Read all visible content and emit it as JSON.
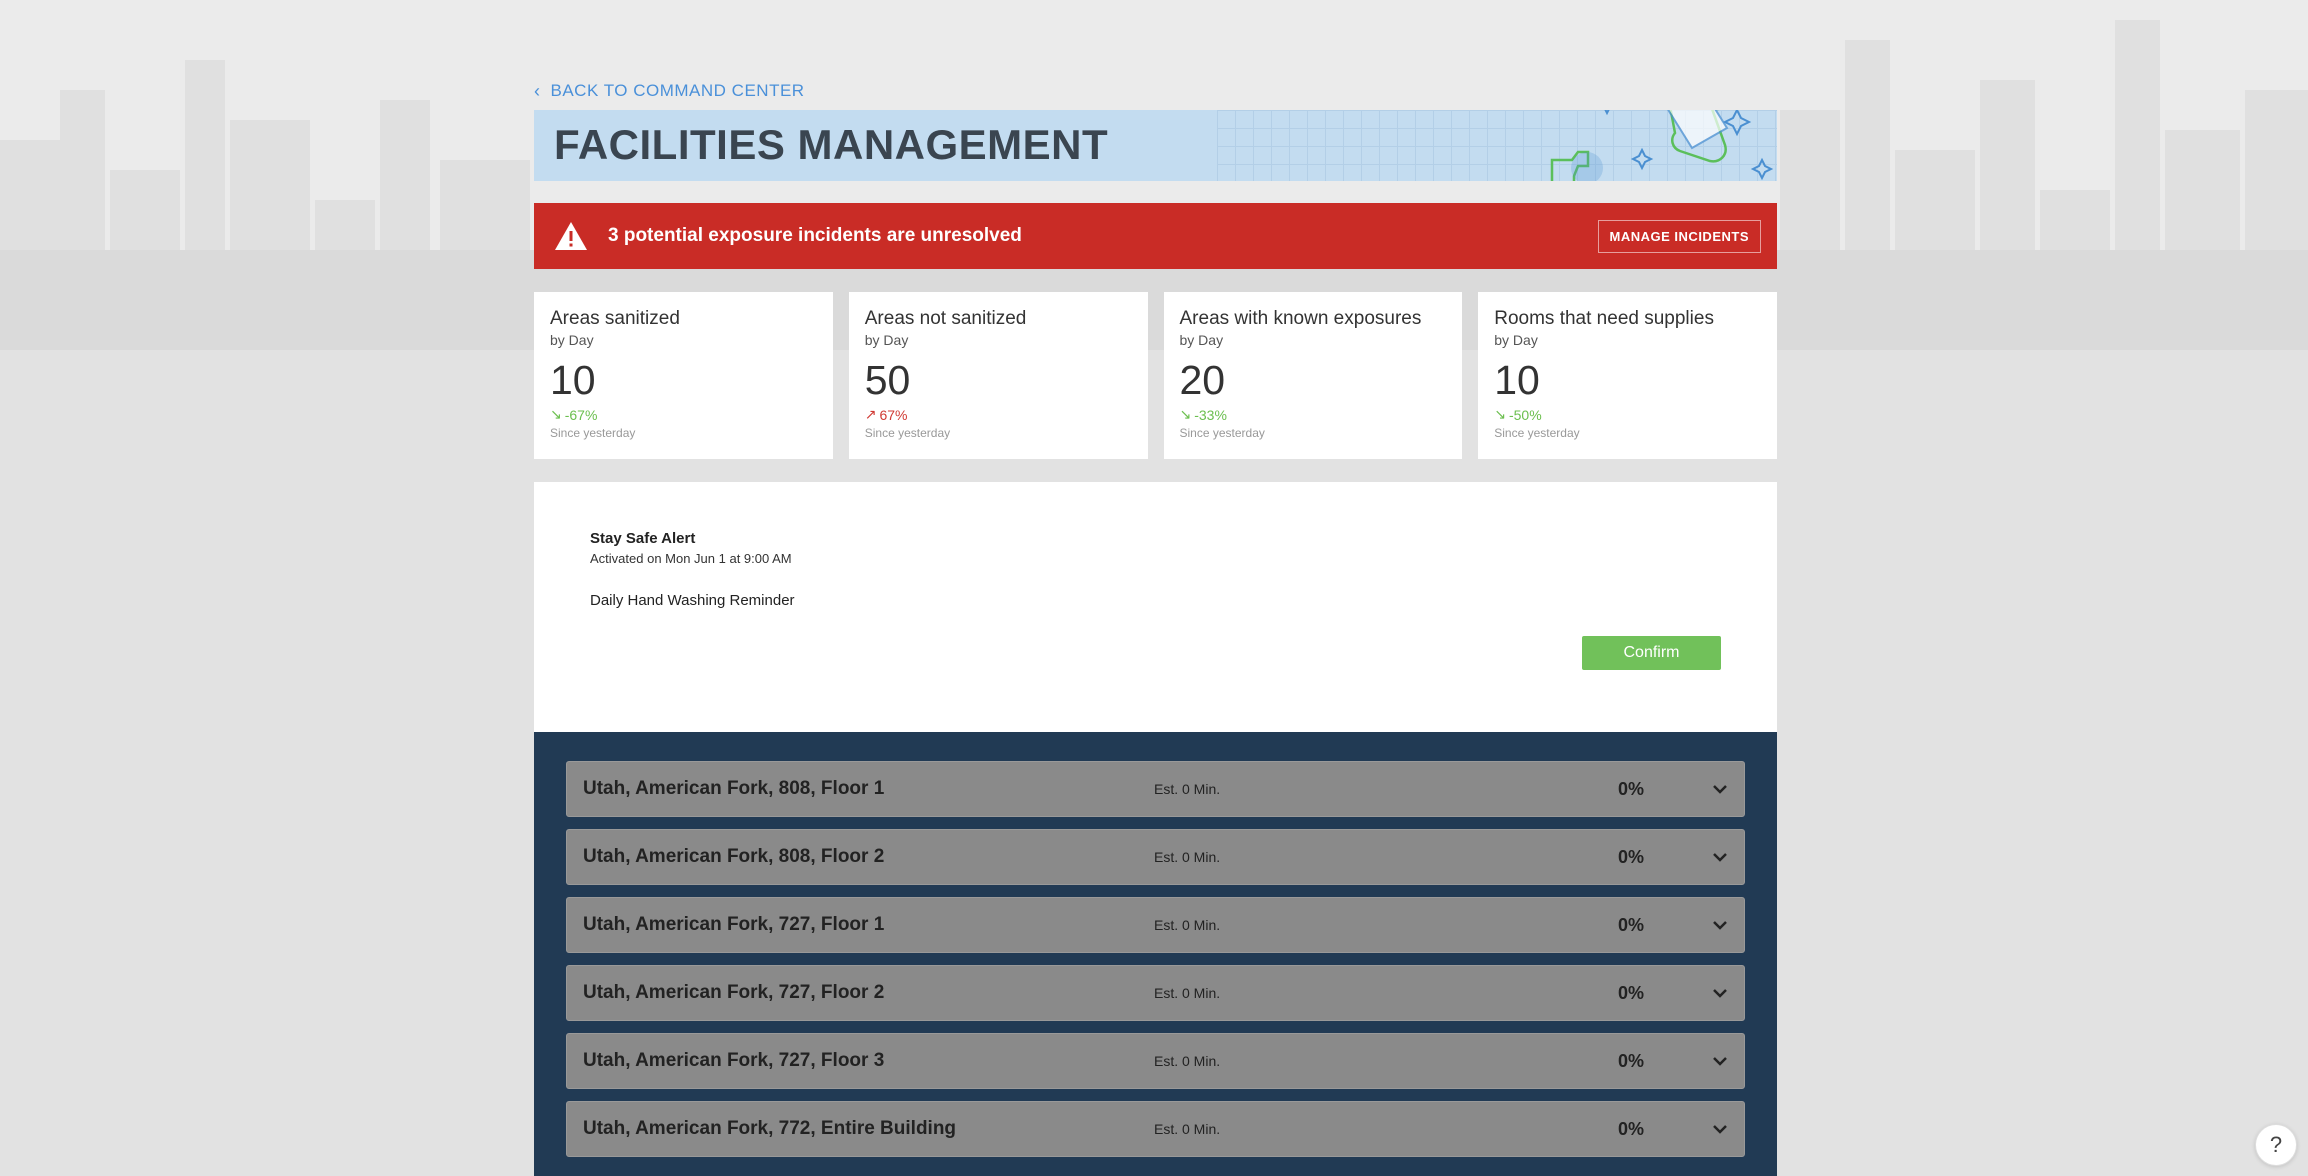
{
  "nav": {
    "back_label": "BACK TO COMMAND CENTER"
  },
  "header": {
    "title": "FACILITIES MANAGEMENT"
  },
  "alert": {
    "message": "3 potential exposure incidents are unresolved",
    "button_label": "MANAGE INCIDENTS",
    "color": "#c92c26"
  },
  "stats": [
    {
      "title": "Areas sanitized",
      "sub": "by Day",
      "value": "10",
      "change": "-67%",
      "direction": "down",
      "since": "Since yesterday"
    },
    {
      "title": "Areas not sanitized",
      "sub": "by Day",
      "value": "50",
      "change": "67%",
      "direction": "up",
      "since": "Since yesterday"
    },
    {
      "title": "Areas with known exposures",
      "sub": "by Day",
      "value": "20",
      "change": "-33%",
      "direction": "down",
      "since": "Since yesterday"
    },
    {
      "title": "Rooms that need supplies",
      "sub": "by Day",
      "value": "10",
      "change": "-50%",
      "direction": "down",
      "since": "Since yesterday"
    }
  ],
  "safe_alert": {
    "title": "Stay Safe Alert",
    "activated": "Activated on Mon Jun 1 at 9:00 AM",
    "body": "Daily Hand Washing Reminder",
    "confirm_label": "Confirm"
  },
  "areas": [
    {
      "name": "Utah, American Fork, 808, Floor 1",
      "est": "Est. 0 Min.",
      "pct": "0%"
    },
    {
      "name": "Utah, American Fork, 808, Floor 2",
      "est": "Est. 0 Min.",
      "pct": "0%"
    },
    {
      "name": "Utah, American Fork, 727, Floor 1",
      "est": "Est. 0 Min.",
      "pct": "0%"
    },
    {
      "name": "Utah, American Fork, 727, Floor 2",
      "est": "Est. 0 Min.",
      "pct": "0%"
    },
    {
      "name": "Utah, American Fork, 727, Floor 3",
      "est": "Est. 0 Min.",
      "pct": "0%"
    },
    {
      "name": "Utah, American Fork, 772, Entire Building",
      "est": "Est. 0 Min.",
      "pct": "0%"
    }
  ],
  "help": {
    "label": "?"
  },
  "colors": {
    "accent_blue": "#4a90d9",
    "confirm_green": "#71c15a",
    "trend_down": "#6bbf4e",
    "trend_up": "#d03a33",
    "areas_bg": "#213a54"
  }
}
